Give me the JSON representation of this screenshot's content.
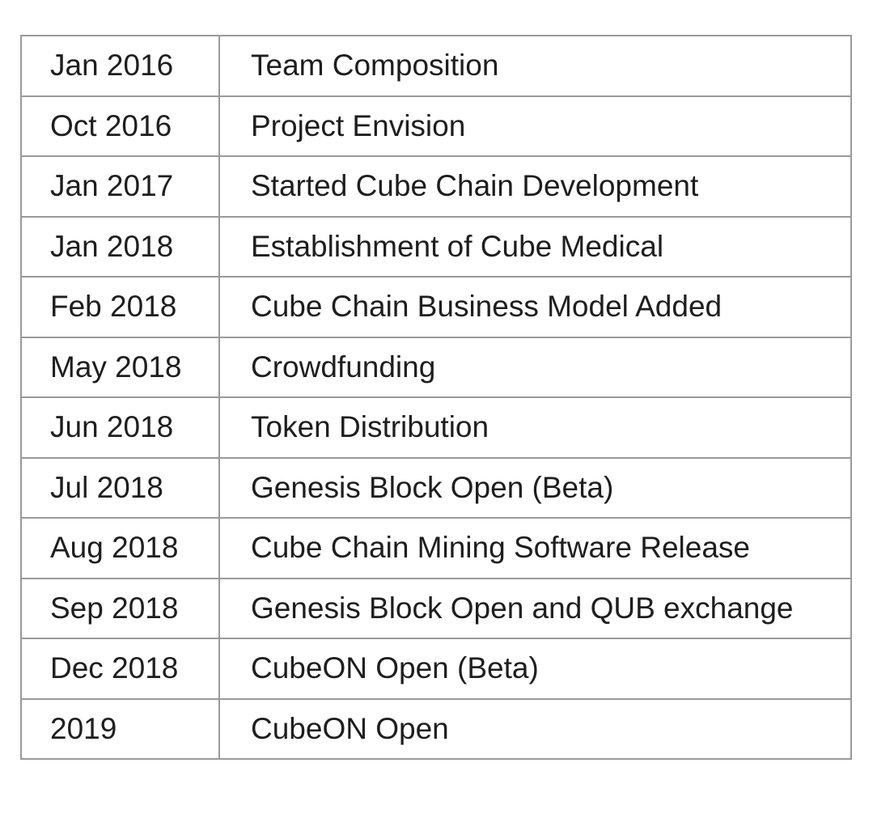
{
  "timeline": {
    "rows": [
      {
        "date": "Jan 2016",
        "event": "Team Composition"
      },
      {
        "date": "Oct 2016",
        "event": "Project Envision"
      },
      {
        "date": "Jan 2017",
        "event": "Started Cube Chain Development"
      },
      {
        "date": "Jan 2018",
        "event": "Establishment of Cube Medical"
      },
      {
        "date": "Feb 2018",
        "event": "Cube Chain Business Model Added"
      },
      {
        "date": "May 2018",
        "event": "Crowdfunding"
      },
      {
        "date": "Jun 2018",
        "event": "Token Distribution"
      },
      {
        "date": "Jul 2018",
        "event": "Genesis Block Open (Beta)"
      },
      {
        "date": "Aug 2018",
        "event": "Cube Chain Mining Software Release"
      },
      {
        "date": "Sep 2018",
        "event": "Genesis Block Open and QUB exchange"
      },
      {
        "date": "Dec 2018",
        "event": "CubeON Open (Beta)"
      },
      {
        "date": "2019",
        "event": "CubeON Open"
      }
    ]
  }
}
